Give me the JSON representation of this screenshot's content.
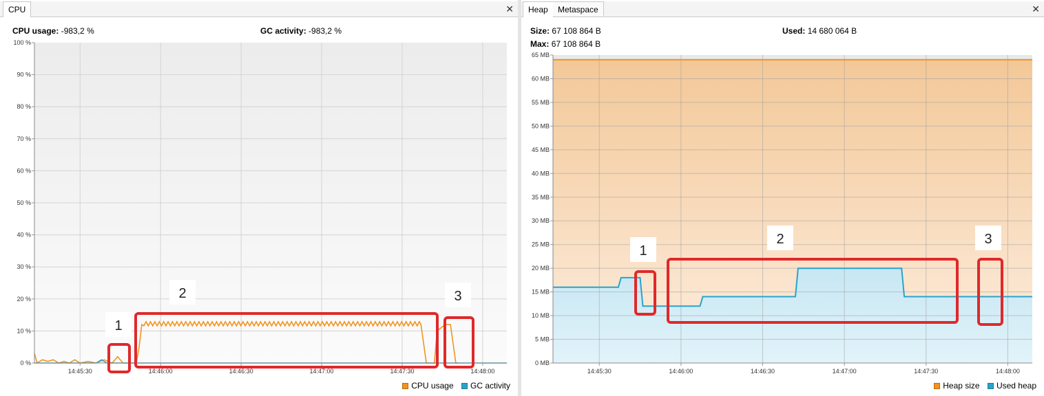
{
  "cpu": {
    "tab_label": "CPU",
    "close_glyph": "✕",
    "cpu_usage_label": "CPU usage:",
    "cpu_usage_value": "-983,2 %",
    "gc_activity_label": "GC activity:",
    "gc_activity_value": "-983,2 %",
    "legend": [
      {
        "label": "CPU usage",
        "color": "#f0941f"
      },
      {
        "label": "GC activity",
        "color": "#2aa3cc"
      }
    ],
    "annotations": [
      "1",
      "2",
      "3"
    ]
  },
  "memory": {
    "tabs": [
      "Heap",
      "Metaspace"
    ],
    "active_tab": "Heap",
    "close_glyph": "✕",
    "size_label": "Size:",
    "size_value": "67 108 864 B",
    "used_label": "Used:",
    "used_value": "14 680 064 B",
    "max_label": "Max:",
    "max_value": "67 108 864 B",
    "legend": [
      {
        "label": "Heap size",
        "color": "#f0941f"
      },
      {
        "label": "Used heap",
        "color": "#2aa3cc"
      }
    ],
    "annotations": [
      "1",
      "2",
      "3"
    ]
  },
  "chart_data": [
    {
      "type": "line",
      "ylim": [
        0,
        100
      ],
      "y_ticks": [
        "0 %",
        "10 %",
        "20 %",
        "30 %",
        "40 %",
        "50 %",
        "60 %",
        "70 %",
        "80 %",
        "90 %",
        "100 %"
      ],
      "x_ticks": [
        "14:45:30",
        "14:46:00",
        "14:46:30",
        "14:47:00",
        "14:47:30",
        "14:48:00"
      ],
      "grid": true,
      "legend_position": "bottom-right",
      "series": [
        {
          "name": "CPU usage",
          "color": "#f0941f",
          "x": [
            "14:45:13",
            "14:45:14",
            "14:45:16",
            "14:45:18",
            "14:45:20",
            "14:45:22",
            "14:45:24",
            "14:45:26",
            "14:45:28",
            "14:45:30",
            "14:45:33",
            "14:45:36",
            "14:45:39",
            "14:45:42",
            "14:45:44",
            "14:45:46",
            "14:45:48",
            "14:45:49",
            "14:45:50",
            "14:45:51",
            "14:45:52",
            "14:45:53",
            "14:45:55",
            "14:46:00",
            "14:46:10",
            "14:46:20",
            "14:46:30",
            "14:46:40",
            "14:46:50",
            "14:47:00",
            "14:47:10",
            "14:47:20",
            "14:47:30",
            "14:47:37",
            "14:47:39",
            "14:47:40",
            "14:47:42",
            "14:47:43",
            "14:47:46",
            "14:47:48",
            "14:47:50",
            "14:47:51"
          ],
          "values": [
            3,
            0,
            1,
            0.5,
            1,
            0,
            0.5,
            0,
            1,
            0,
            0.5,
            0,
            1,
            0,
            2,
            0,
            0,
            0,
            0,
            0,
            5,
            12,
            12,
            12,
            12,
            12,
            12,
            12,
            12,
            12,
            12,
            12,
            12,
            12,
            0,
            0,
            0,
            10,
            12,
            12,
            0,
            0
          ]
        },
        {
          "name": "GC activity",
          "color": "#2aa3cc",
          "x": [
            "14:45:13",
            "14:45:36",
            "14:45:38",
            "14:45:40",
            "14:45:45",
            "14:48:00",
            "14:48:09"
          ],
          "values": [
            0,
            0,
            1,
            0,
            0,
            0,
            0
          ]
        }
      ]
    },
    {
      "type": "area",
      "ylim": [
        0,
        65
      ],
      "y_ticks": [
        "0 MB",
        "5 MB",
        "10 MB",
        "15 MB",
        "20 MB",
        "25 MB",
        "30 MB",
        "35 MB",
        "40 MB",
        "45 MB",
        "50 MB",
        "55 MB",
        "60 MB",
        "65 MB"
      ],
      "x_ticks": [
        "14:45:30",
        "14:46:00",
        "14:46:30",
        "14:47:00",
        "14:47:30",
        "14:48:00"
      ],
      "grid": true,
      "legend_position": "bottom-right",
      "series": [
        {
          "name": "Heap size",
          "color": "#f0941f",
          "x": [
            "14:45:13",
            "14:48:09"
          ],
          "values": [
            64,
            64
          ]
        },
        {
          "name": "Used heap",
          "color": "#2aa3cc",
          "x": [
            "14:45:13",
            "14:45:37",
            "14:45:38",
            "14:45:45",
            "14:45:46",
            "14:46:07",
            "14:46:08",
            "14:46:42",
            "14:46:43",
            "14:47:21",
            "14:47:22",
            "14:48:09"
          ],
          "values": [
            16,
            16,
            18,
            18,
            12,
            12,
            14,
            14,
            20,
            20,
            14,
            14
          ]
        }
      ]
    }
  ]
}
